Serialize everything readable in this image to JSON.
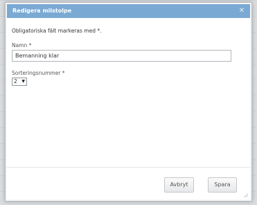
{
  "dialog": {
    "title": "Redigera milstolpe",
    "close_icon": "close-icon"
  },
  "form": {
    "required_note": "Obligatoriska fält markeras med *.",
    "name": {
      "label": "Namn *",
      "value": "Bemanning klar"
    },
    "sort_number": {
      "label": "Sorteringsnummer *",
      "value": "2",
      "arrow_icon": "chevron-down-icon"
    }
  },
  "buttons": {
    "cancel_label": "Avbryt",
    "save_label": "Spara"
  },
  "colors": {
    "titlebar": "#7aaad4",
    "dialog_background": "#ffffff"
  }
}
